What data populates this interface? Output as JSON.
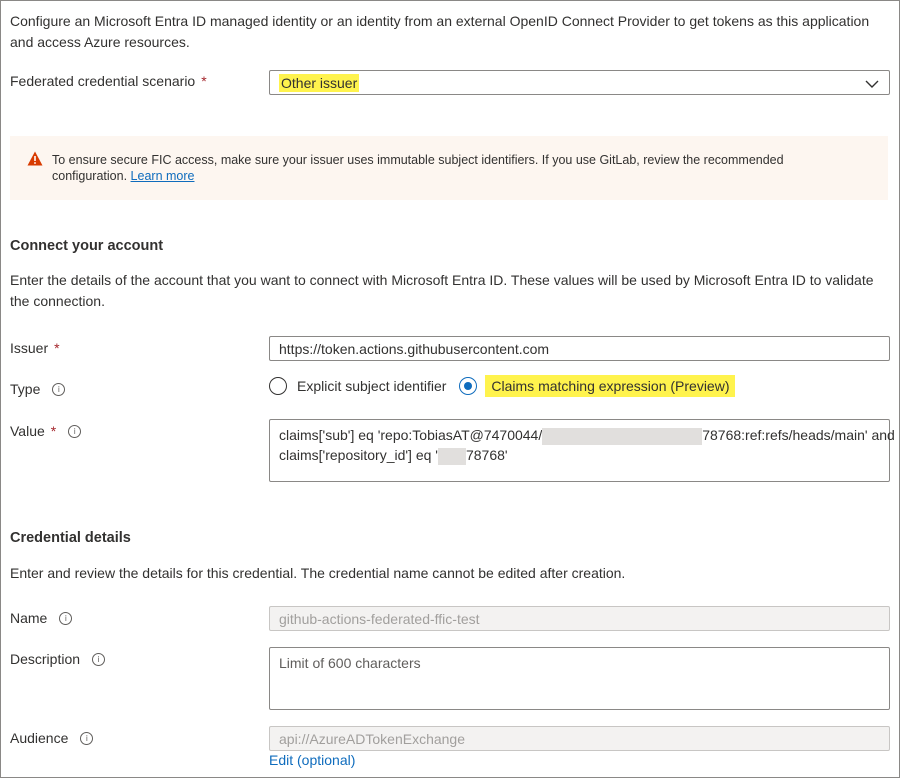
{
  "intro": "Configure an Microsoft Entra ID managed identity or an identity from an external OpenID Connect Provider to get tokens as this application and access Azure resources.",
  "scenario": {
    "label": "Federated credential scenario",
    "required": "*",
    "value": "Other issuer"
  },
  "warning": {
    "text": "To ensure secure FIC access, make sure your issuer uses immutable subject identifiers. If you use GitLab, review the recommended configuration.",
    "link": "Learn more"
  },
  "connect": {
    "heading": "Connect your account",
    "description": "Enter the details of the account that you want to connect with Microsoft Entra ID. These values will be used by Microsoft Entra ID to validate the connection.",
    "issuer_label": "Issuer",
    "issuer_required": "*",
    "issuer_value": "https://token.actions.githubusercontent.com",
    "type_label": "Type",
    "type_options": [
      "Explicit subject identifier",
      "Claims matching expression (Preview)"
    ],
    "type_selected": "Claims matching expression (Preview)",
    "value_label": "Value",
    "value_required": "*",
    "value_line1_a": "claims['sub'] eq 'repo:TobiasAT@7470044/",
    "value_line1_b": "78768:ref:refs/heads/main' and",
    "value_line2_a": "claims['repository_id'] eq '",
    "value_line2_b": "78768'"
  },
  "credential": {
    "heading": "Credential details",
    "description": "Enter and review the details for this credential. The credential name cannot be edited after creation.",
    "name_label": "Name",
    "name_value": "github-actions-federated-ffic-test",
    "description_label": "Description",
    "description_placeholder": "Limit of 600 characters",
    "audience_label": "Audience",
    "audience_value": "api://AzureADTokenExchange",
    "edit_link": "Edit (optional)"
  },
  "colors": {
    "highlight": "#fff34d",
    "link": "#0f6cbd",
    "required": "#a4262c",
    "warning_icon": "#d83b01",
    "warning_bg": "#fdf6f0"
  },
  "icons": [
    "chevron-down-icon",
    "warning-icon",
    "info-icon"
  ]
}
